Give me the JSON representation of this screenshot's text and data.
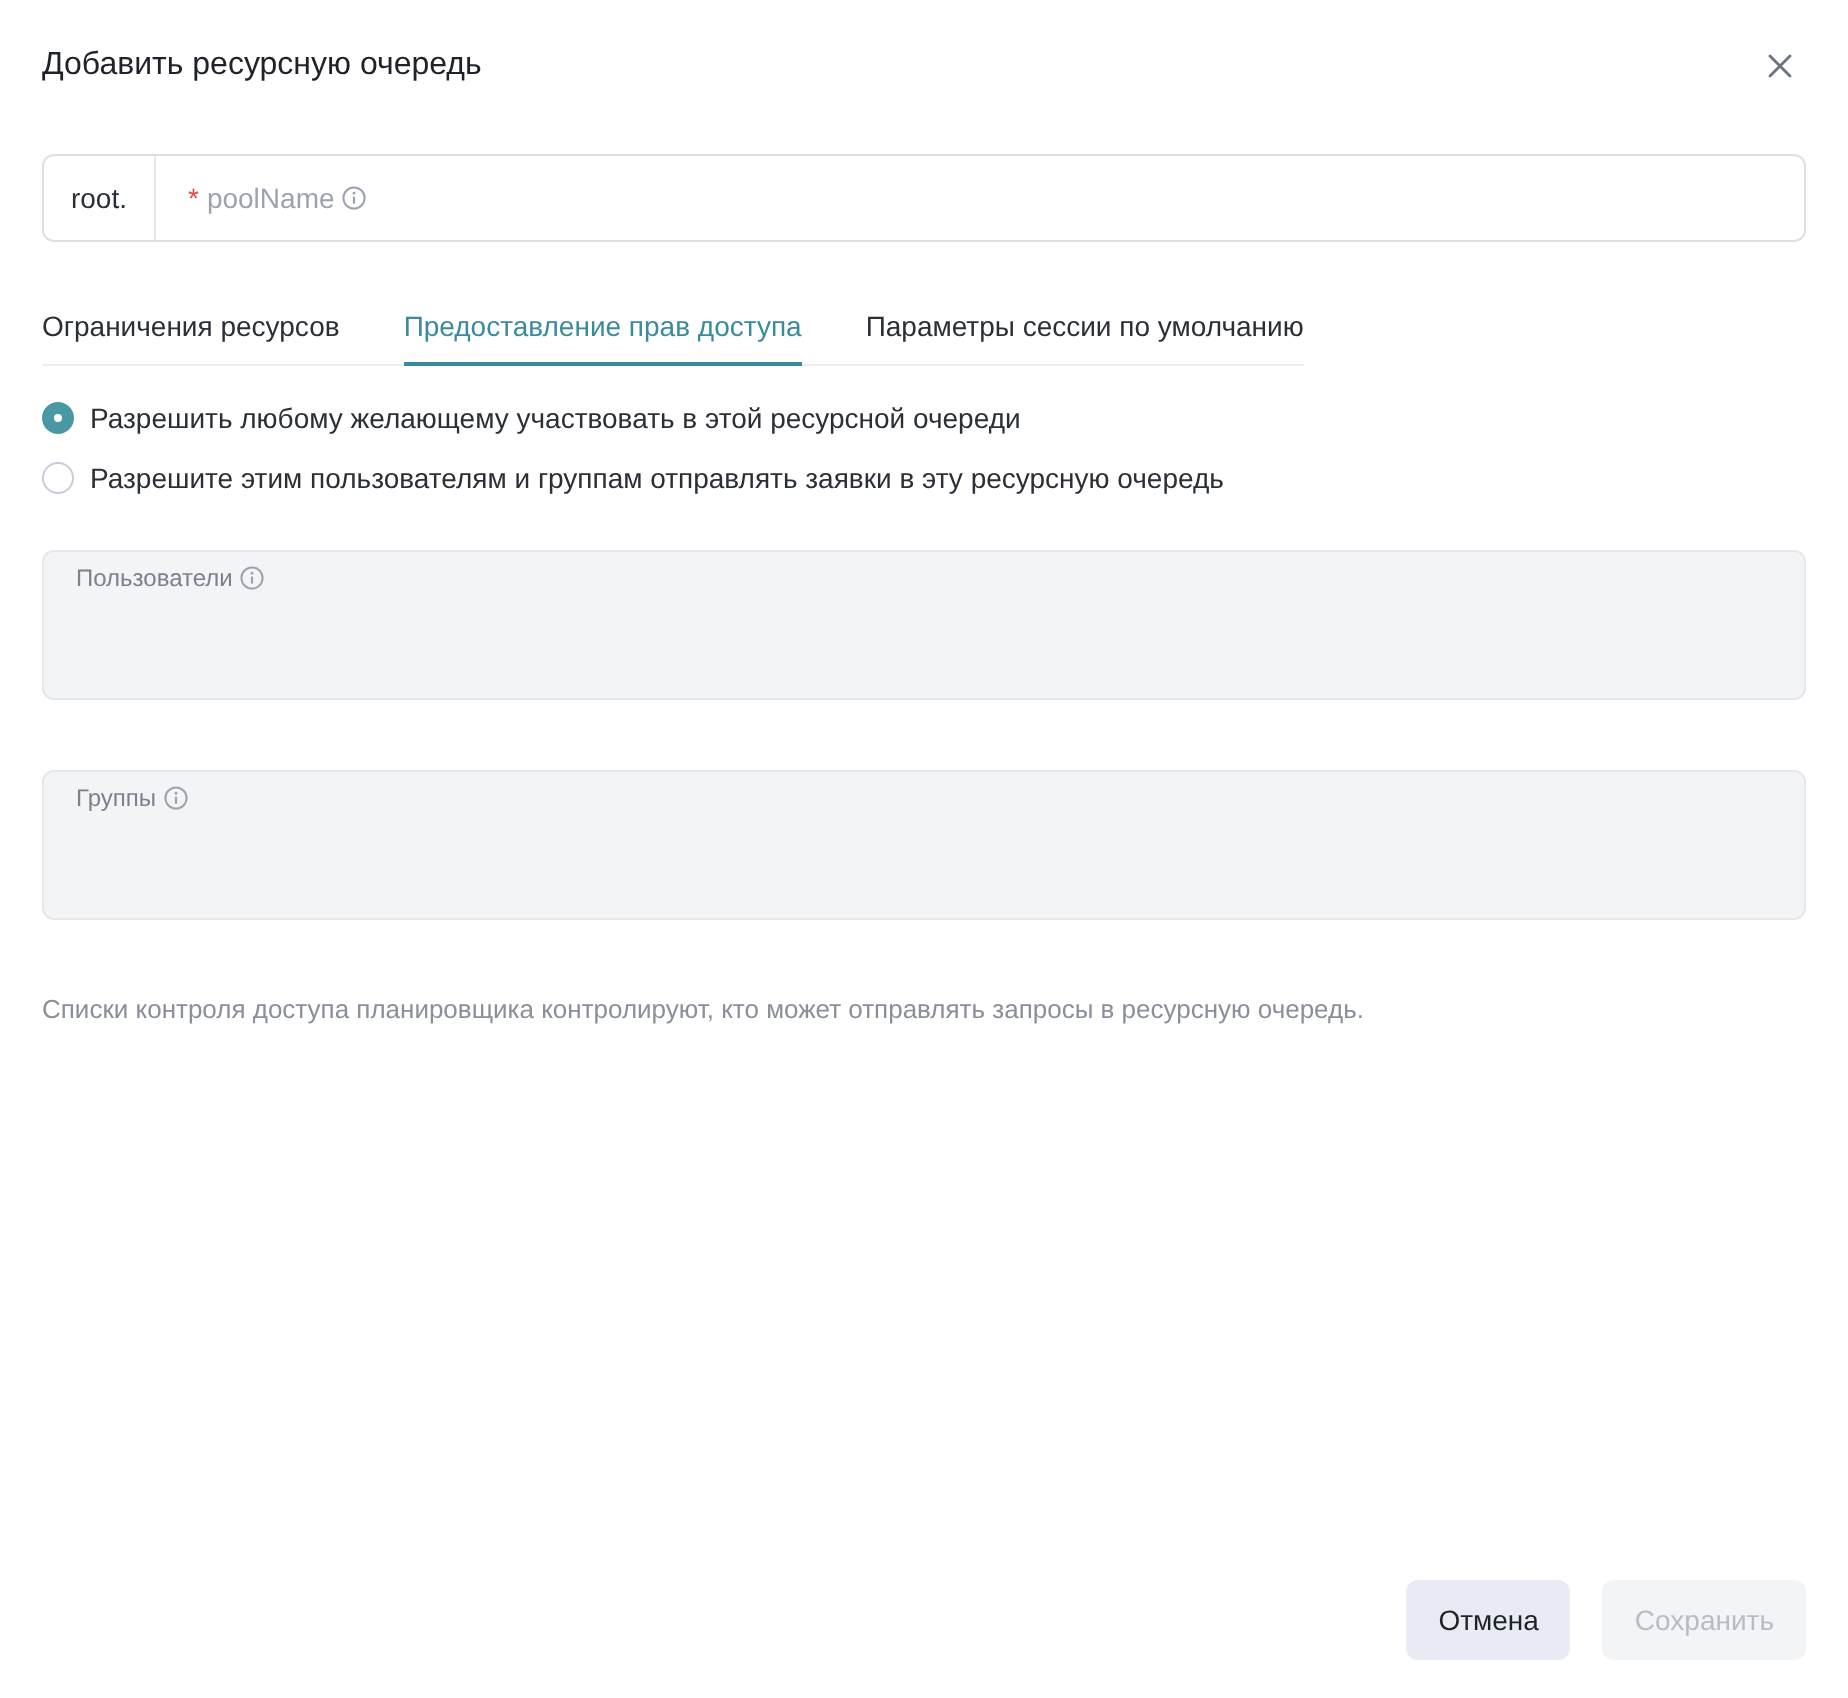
{
  "dialog": {
    "title": "Добавить ресурсную очередь"
  },
  "pool_name": {
    "prefix": "root.",
    "required_mark": "*",
    "label": "poolName"
  },
  "tabs": [
    {
      "label": "Ограничения ресурсов",
      "selected": false
    },
    {
      "label": "Предоставление прав доступа",
      "selected": true
    },
    {
      "label": "Параметры сессии по умолчанию",
      "selected": false
    }
  ],
  "access_options": [
    {
      "label": "Разрешить любому желающему участвовать в этой ресурсной очереди",
      "selected": true
    },
    {
      "label": "Разрешите этим пользователям и группам отправлять заявки в эту ресурсную очередь",
      "selected": false
    }
  ],
  "list_fields": [
    {
      "label": "Пользователи",
      "disabled": true
    },
    {
      "label": "Группы",
      "disabled": true
    }
  ],
  "help_text": "Списки контроля доступа планировщика контролируют, кто может отправлять запросы в ресурсную очередь.",
  "buttons": [
    {
      "label": "Отмена",
      "kind": "secondary",
      "disabled": false
    },
    {
      "label": "Сохранить",
      "kind": "primary",
      "disabled": true
    }
  ]
}
